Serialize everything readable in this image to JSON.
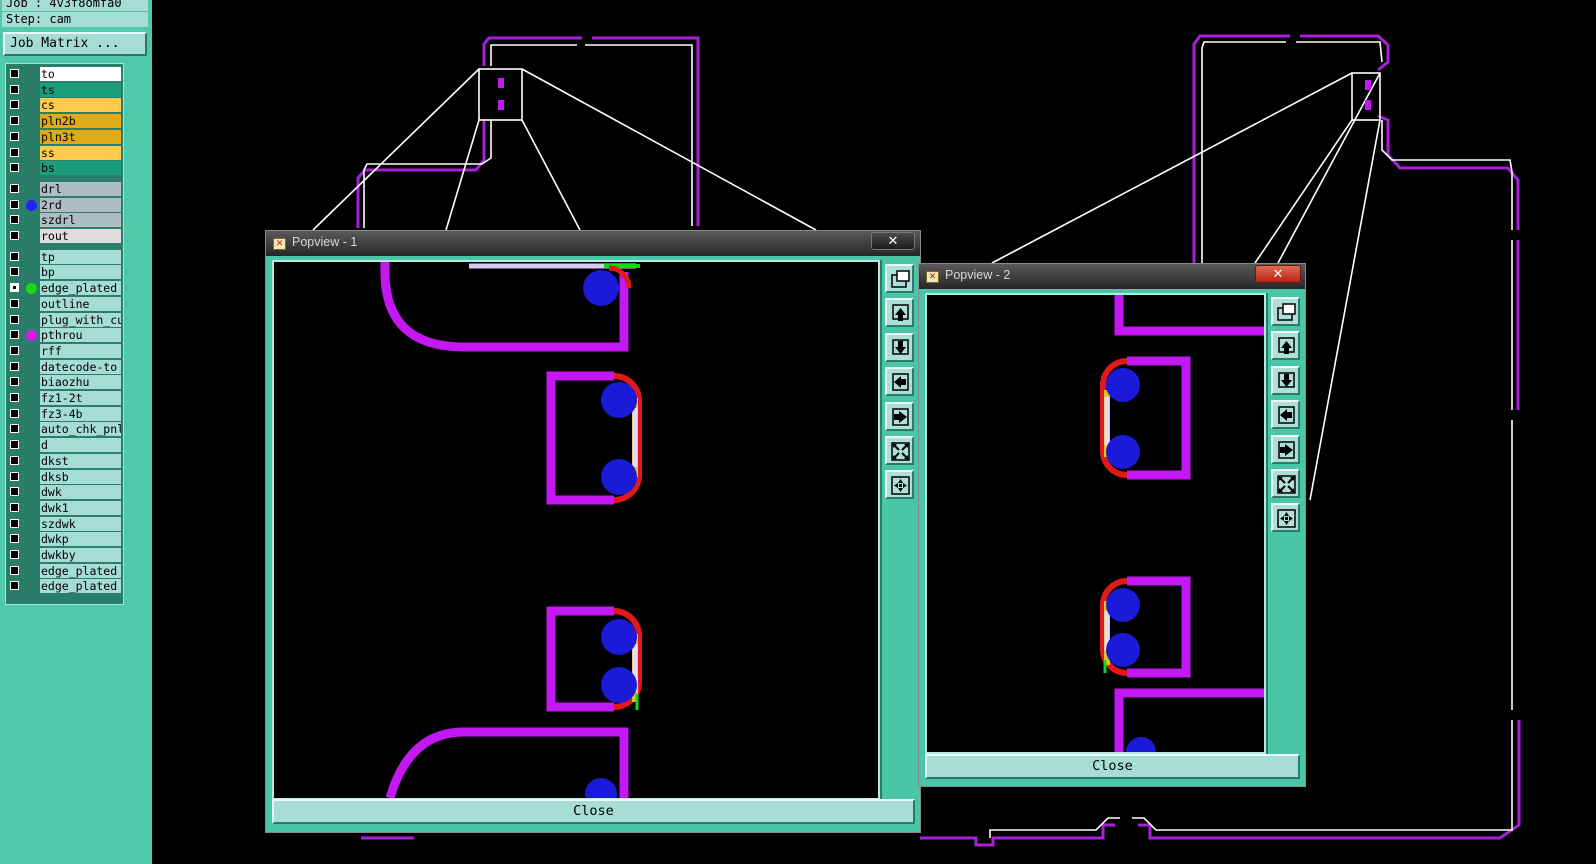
{
  "header": {
    "job_label": "Job : 4v3f8omfa0",
    "step_label": "Step: cam"
  },
  "job_matrix_button": "Job Matrix ...",
  "layers": [
    {
      "name": "to",
      "bg": "#ffffff",
      "checked": false,
      "dot": ""
    },
    {
      "name": "ts",
      "bg": "#1a9d7a",
      "checked": false,
      "dot": ""
    },
    {
      "name": "cs",
      "bg": "#ffc94c",
      "checked": false,
      "dot": ""
    },
    {
      "name": "pln2b",
      "bg": "#e3aa14",
      "checked": false,
      "dot": ""
    },
    {
      "name": "pln3t",
      "bg": "#e3aa14",
      "checked": false,
      "dot": ""
    },
    {
      "name": "ss",
      "bg": "#ffc94c",
      "checked": false,
      "dot": ""
    },
    {
      "name": "bs",
      "bg": "#1a9d7a",
      "checked": false,
      "dot": ""
    },
    {
      "name": "drl",
      "bg": "#b0bcc4",
      "checked": false,
      "dot": ""
    },
    {
      "name": "2rd",
      "bg": "#b0bcc4",
      "checked": false,
      "dot": "#2222ff"
    },
    {
      "name": "szdrl",
      "bg": "#b0bcc4",
      "checked": false,
      "dot": ""
    },
    {
      "name": "rout",
      "bg": "#dddddd",
      "checked": false,
      "dot": ""
    },
    {
      "name": "tp",
      "bg": "#a5dcd6",
      "checked": false,
      "dot": ""
    },
    {
      "name": "bp",
      "bg": "#a5dcd6",
      "checked": false,
      "dot": ""
    },
    {
      "name": "edge_plated",
      "bg": "#a5dcd6",
      "checked": true,
      "dot": "#18d718"
    },
    {
      "name": "outline",
      "bg": "#a5dcd6",
      "checked": false,
      "dot": ""
    },
    {
      "name": "plug_with_cu",
      "bg": "#a5dcd6",
      "checked": false,
      "dot": ""
    },
    {
      "name": "pthrou",
      "bg": "#a5dcd6",
      "checked": false,
      "dot": "#d81ce8"
    },
    {
      "name": "rff",
      "bg": "#a5dcd6",
      "checked": false,
      "dot": ""
    },
    {
      "name": "datecode-to",
      "bg": "#a5dcd6",
      "checked": false,
      "dot": ""
    },
    {
      "name": "biaozhu",
      "bg": "#a5dcd6",
      "checked": false,
      "dot": ""
    },
    {
      "name": "fz1-2t",
      "bg": "#a5dcd6",
      "checked": false,
      "dot": ""
    },
    {
      "name": "fz3-4b",
      "bg": "#a5dcd6",
      "checked": false,
      "dot": ""
    },
    {
      "name": "auto_chk_pnl",
      "bg": "#a5dcd6",
      "checked": false,
      "dot": ""
    },
    {
      "name": "d",
      "bg": "#a5dcd6",
      "checked": false,
      "dot": ""
    },
    {
      "name": "dkst",
      "bg": "#a5dcd6",
      "checked": false,
      "dot": ""
    },
    {
      "name": "dksb",
      "bg": "#a5dcd6",
      "checked": false,
      "dot": ""
    },
    {
      "name": "dwk",
      "bg": "#a5dcd6",
      "checked": false,
      "dot": ""
    },
    {
      "name": "dwk1",
      "bg": "#a5dcd6",
      "checked": false,
      "dot": ""
    },
    {
      "name": "szdwk",
      "bg": "#a5dcd6",
      "checked": false,
      "dot": ""
    },
    {
      "name": "dwkp",
      "bg": "#a5dcd6",
      "checked": false,
      "dot": ""
    },
    {
      "name": "dwkby",
      "bg": "#a5dcd6",
      "checked": false,
      "dot": ""
    },
    {
      "name": "edge_plated",
      "bg": "#a5dcd6",
      "checked": false,
      "dot": ""
    },
    {
      "name": "edge_plated",
      "bg": "#a5dcd6",
      "checked": false,
      "dot": ""
    }
  ],
  "popview1": {
    "title": "Popview - 1",
    "close_label": "Close",
    "close_x": "✕"
  },
  "popview2": {
    "title": "Popview - 2",
    "close_label": "Close",
    "close_x": "✕"
  },
  "colors": {
    "magenta": "#c318f2",
    "blue": "#1a1ad8",
    "red": "#e01a1a",
    "yellow": "#e3c02a",
    "green": "#18d718",
    "teal": "#48c6a7"
  },
  "toolbar_icons": [
    "layers-icon",
    "zoom-up-icon",
    "zoom-down-icon",
    "pan-left-icon",
    "pan-right-icon",
    "fit-icon",
    "center-icon"
  ]
}
